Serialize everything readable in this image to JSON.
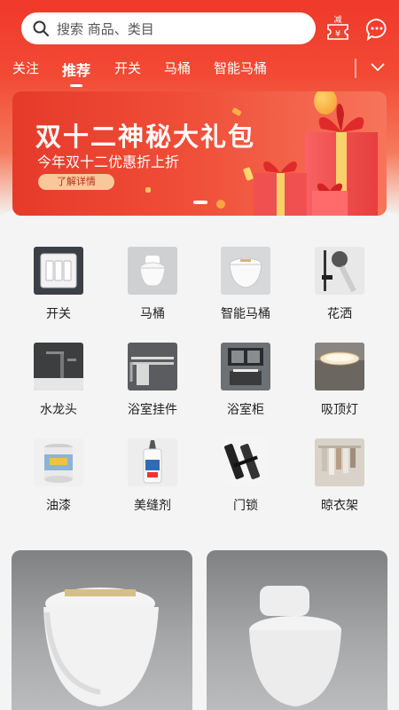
{
  "header": {
    "search_placeholder": "搜索 商品、类目",
    "coupon_badge": "减",
    "coupon_symbol": "¥"
  },
  "tabs": [
    {
      "label": "关注",
      "active": false
    },
    {
      "label": "推荐",
      "active": true
    },
    {
      "label": "开关",
      "active": false
    },
    {
      "label": "马桶",
      "active": false
    },
    {
      "label": "智能马桶",
      "active": false
    }
  ],
  "banner": {
    "title": "双十二神秘大礼包",
    "subtitle": "今年双十二优惠折上折",
    "button_label": "了解详情"
  },
  "categories": [
    {
      "label": "开关",
      "icon": "switch"
    },
    {
      "label": "马桶",
      "icon": "toilet"
    },
    {
      "label": "智能马桶",
      "icon": "smart-toilet"
    },
    {
      "label": "花洒",
      "icon": "shower"
    },
    {
      "label": "水龙头",
      "icon": "faucet"
    },
    {
      "label": "浴室挂件",
      "icon": "towel-rack"
    },
    {
      "label": "浴室柜",
      "icon": "bathroom-cabinet"
    },
    {
      "label": "吸顶灯",
      "icon": "ceiling-lamp"
    },
    {
      "label": "油漆",
      "icon": "paint-bucket"
    },
    {
      "label": "美缝剂",
      "icon": "grout"
    },
    {
      "label": "门锁",
      "icon": "door-lock"
    },
    {
      "label": "晾衣架",
      "icon": "clothes-rack"
    }
  ],
  "colors": {
    "brand_red": "#f0392a",
    "banner_button": "#f8c89a"
  }
}
